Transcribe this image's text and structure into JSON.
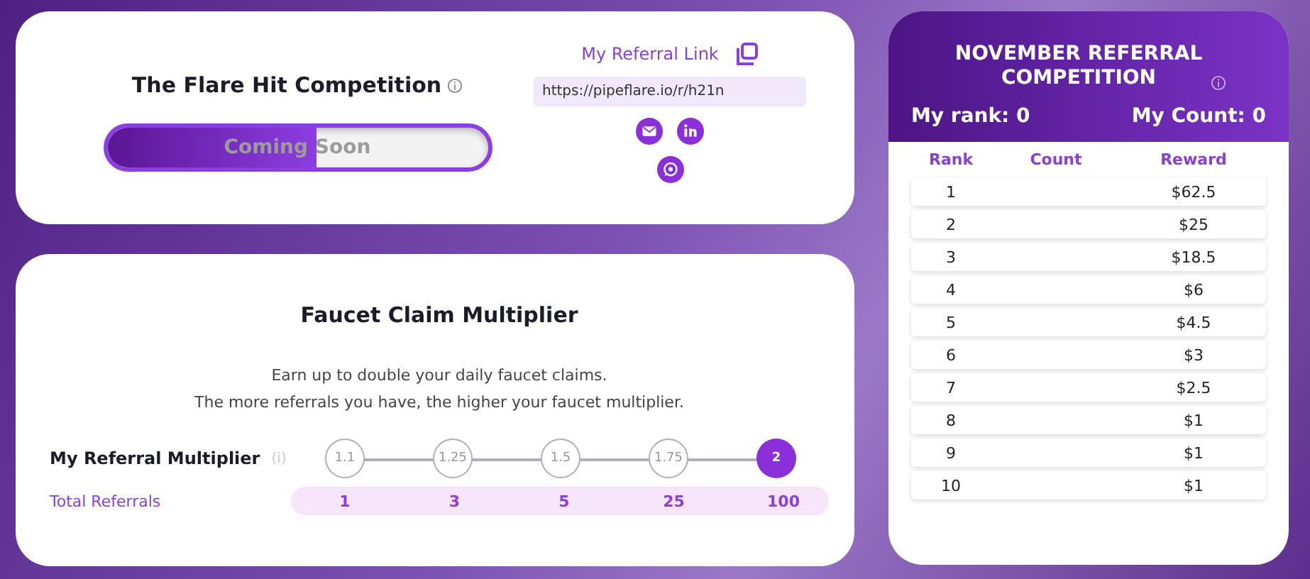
{
  "competition": {
    "title": "The Flare Hit Competition",
    "progress": {
      "label": "Coming Soon",
      "level": 0.55
    }
  },
  "referral": {
    "title": "My Referral Link",
    "link": "https://pipeflare.io/r/h21n"
  },
  "multiplier": {
    "title": "Faucet Claim Multiplier",
    "description": [
      "Earn up to double your daily faucet claims.",
      "The more referrals you have, the higher your faucet multiplier."
    ],
    "row_label": "My Referral Multiplier",
    "info": "(i)",
    "referrals_label": "Total Referrals",
    "steps": [
      {
        "multiplier": "1.1",
        "referrals": "1",
        "selected": false
      },
      {
        "multiplier": "1.25",
        "referrals": "3",
        "selected": false
      },
      {
        "multiplier": "1.5",
        "referrals": "5",
        "selected": false
      },
      {
        "multiplier": "1.75",
        "referrals": "25",
        "selected": false
      },
      {
        "multiplier": "2",
        "referrals": "100",
        "selected": true
      }
    ]
  },
  "leaderboard": {
    "title": "NOVEMBER REFERRAL COMPETITION",
    "my_rank": "My rank: 0",
    "my_count": "My Count: 0",
    "columns": [
      "Rank",
      "Count",
      "Reward"
    ],
    "rows": [
      [
        "1",
        "",
        "$62.5"
      ],
      [
        "2",
        "",
        "$25"
      ],
      [
        "3",
        "",
        "$18.5"
      ],
      [
        "4",
        "",
        "$6"
      ],
      [
        "5",
        "",
        "$4.5"
      ],
      [
        "6",
        "",
        "$3"
      ],
      [
        "7",
        "",
        "$2.5"
      ],
      [
        "8",
        "",
        "$1"
      ],
      [
        "9",
        "",
        "$1"
      ],
      [
        "10",
        "",
        "$1"
      ]
    ]
  }
}
